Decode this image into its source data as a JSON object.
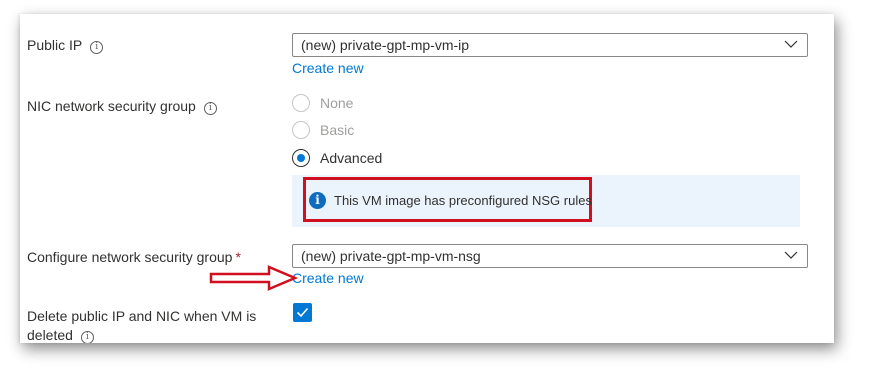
{
  "public_ip": {
    "label": "Public IP",
    "value": "(new) private-gpt-mp-vm-ip",
    "create_new": "Create new"
  },
  "nic_nsg": {
    "label": "NIC network security group",
    "options": [
      {
        "label": "None",
        "selected": false,
        "disabled": true
      },
      {
        "label": "Basic",
        "selected": false,
        "disabled": true
      },
      {
        "label": "Advanced",
        "selected": true,
        "disabled": false
      }
    ],
    "info_message": "This VM image has preconfigured NSG rules"
  },
  "configure_nsg": {
    "label": "Configure network security group",
    "required_mark": "*",
    "value": "(new) private-gpt-mp-vm-nsg",
    "create_new": "Create new"
  },
  "delete_option": {
    "label_line1": "Delete public IP and NIC when VM is",
    "label_line2": "deleted",
    "checked": true
  },
  "colors": {
    "accent": "#0078d4",
    "info_background": "#ebf3fc",
    "annotation_red": "#d1101f",
    "required": "#a4262c"
  }
}
